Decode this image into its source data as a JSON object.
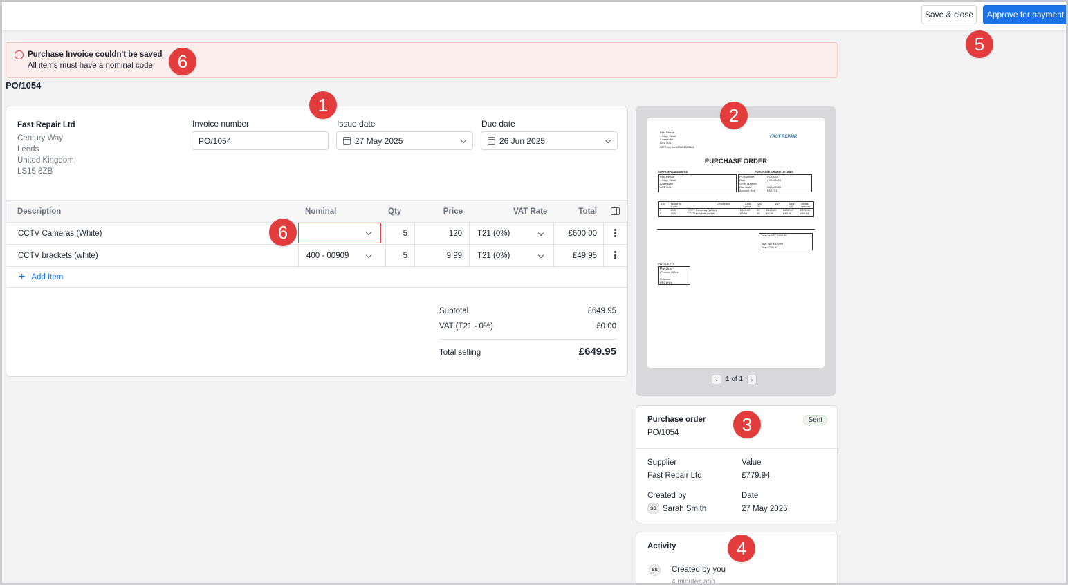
{
  "toolbar": {
    "save_close": "Save & close",
    "approve": "Approve for payment"
  },
  "alert": {
    "title": "Purchase Invoice couldn't be saved",
    "message": "All items must have a nominal code"
  },
  "page_title": "PO/1054",
  "supplier": {
    "name": "Fast Repair Ltd",
    "address": [
      "Century Way",
      "Leeds",
      "United Kingdom",
      "LS15 8ZB"
    ]
  },
  "fields": {
    "invoice_number_label": "Invoice number",
    "invoice_number": "PO/1054",
    "issue_date_label": "Issue date",
    "issue_date": "27 May 2025",
    "due_date_label": "Due date",
    "due_date": "26 Jun 2025"
  },
  "table": {
    "headers": {
      "description": "Description",
      "nominal": "Nominal",
      "qty": "Qty",
      "price": "Price",
      "vat_rate": "VAT Rate",
      "total": "Total"
    },
    "rows": [
      {
        "description": "CCTV Cameras (White)",
        "nominal": "",
        "qty": "5",
        "price": "120",
        "vat": "T21 (0%)",
        "total": "£600.00"
      },
      {
        "description": "CCTV brackets (white)",
        "nominal": "400 - 00909",
        "qty": "5",
        "price": "9.99",
        "vat": "T21 (0%)",
        "total": "£49.95"
      }
    ],
    "add_item": "Add Item"
  },
  "totals": {
    "subtotal_label": "Subtotal",
    "subtotal": "£649.95",
    "vat_label": "VAT (T21 - 0%)",
    "vat": "£0.00",
    "total_label": "Total selling",
    "total": "£649.95"
  },
  "preview": {
    "pager": "1 of 1",
    "doc": {
      "header_lines": [
        "First Repair",
        "1 Main Street",
        "Adamsville",
        "AH1 1LB",
        "VAT Reg No: GB654523665"
      ],
      "logo": "FAST REPAIR",
      "title": "PURCHASE ORDER",
      "suppliers_address": "SUPPLIERS ADDRESS",
      "po_details": "PURCHASE ORDER DETAILS",
      "supplier_lines": [
        "First Repair",
        "1 Main Street",
        "Adamsville",
        "AH1 1LB"
      ],
      "detail_labels": [
        "PO Number:",
        "Date:",
        "Order number:",
        "Due Date:",
        "Account Ref:"
      ],
      "detail_values": [
        "PO/1054",
        "27/05/2025",
        "",
        "26/06/2025",
        "FAST01"
      ],
      "line_headers": [
        "Qty",
        "Nominal Code",
        "Description",
        "Cost price",
        "VAT %",
        "VAT",
        "Total VAT",
        "Gross amount"
      ],
      "line_rows": [
        [
          "5",
          "203",
          "CCTV Cameras (White)",
          "£120.00",
          "20",
          "£120.00",
          "£600.00",
          "£720.00"
        ],
        [
          "5",
          "203",
          "CCTV brackets (white)",
          "£9.99",
          "20",
          "£9.99",
          "£49.95",
          "£59.94"
        ]
      ],
      "total_ex_vat": "Total ex VAT  £649.95",
      "total_vat": "Total VAT  £129.99",
      "total": "Total  £779.94",
      "invoice_to": "INVOICE TO:",
      "invoice_lines": [
        "Pavilion",
        "(Preston Office)",
        "",
        "Fulwood",
        "PR2 8HH"
      ]
    }
  },
  "po_card": {
    "title": "Purchase order",
    "number": "PO/1054",
    "status": "Sent",
    "supplier_label": "Supplier",
    "supplier": "Fast Repair Ltd",
    "value_label": "Value",
    "value": "£779.94",
    "created_by_label": "Created by",
    "created_by_initials": "SS",
    "created_by": "Sarah Smith",
    "date_label": "Date",
    "date": "27 May 2025"
  },
  "activity": {
    "title": "Activity",
    "initials": "SS",
    "text": "Created by you",
    "time": "4 minutes ago"
  },
  "markers": [
    "1",
    "2",
    "3",
    "4",
    "5",
    "6",
    "6"
  ],
  "colors": {
    "primary": "#1a73e8",
    "error": "#e04646",
    "marker": "#e23c3c",
    "alert_bg": "#fdeeee"
  }
}
